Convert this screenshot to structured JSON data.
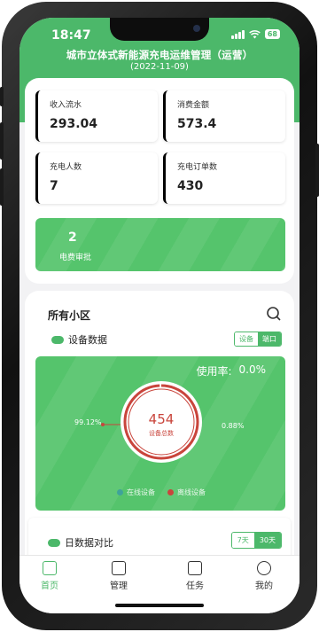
{
  "status_bar": {
    "time": "18:47",
    "battery": "68"
  },
  "header": {
    "title": "城市立体式新能源充电运维管理（运营）",
    "date": "(2022-11-09)"
  },
  "stats": [
    {
      "label": "收入流水",
      "value": "293.04",
      "color": "#8e7ad6"
    },
    {
      "label": "消费金额",
      "value": "573.4",
      "color": "#f1a1b8"
    },
    {
      "label": "充电人数",
      "value": "7",
      "color": "#7fd4e0"
    },
    {
      "label": "充电订单数",
      "value": "430",
      "color": "#7ccf8f"
    }
  ],
  "approval": {
    "count": "2",
    "label": "电费审批"
  },
  "community": {
    "title": "所有小区",
    "device_section": "设备数据",
    "toggle": {
      "active": "设备",
      "inactive": "端口"
    },
    "usage_label": "使用率:",
    "usage_value": "0.0%",
    "total": "454",
    "total_label": "设备总数",
    "offline_pct": "99.12%",
    "online_pct": "0.88%",
    "legend": [
      {
        "label": "在线设备",
        "color": "#3fa39a"
      },
      {
        "label": "离线设备",
        "color": "#c9453c"
      }
    ],
    "offline_fraction": 0.9912
  },
  "daily": {
    "label": "日数据对比",
    "toggle": {
      "active": "7天",
      "inactive": "30天"
    }
  },
  "tabs": [
    {
      "label": "首页",
      "icon": "charger-icon",
      "active": true
    },
    {
      "label": "管理",
      "icon": "monitor-icon",
      "active": false
    },
    {
      "label": "任务",
      "icon": "task-card-icon",
      "active": false
    },
    {
      "label": "我的",
      "icon": "smile-icon",
      "active": false
    }
  ],
  "colors": {
    "primary": "#4cb86a",
    "accent_red": "#c9453c"
  }
}
